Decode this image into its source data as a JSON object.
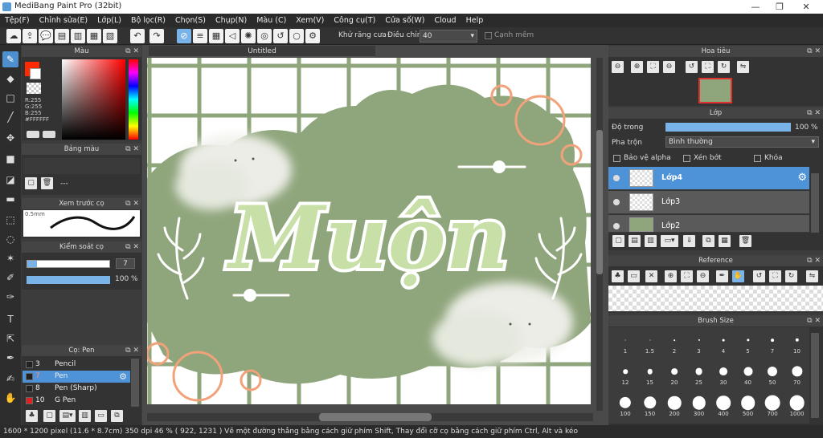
{
  "title": "MediBang Paint Pro (32bit)",
  "menu": [
    "Tệp(F)",
    "Chỉnh sửa(E)",
    "Lớp(L)",
    "Bộ lọc(R)",
    "Chọn(S)",
    "Chụp(N)",
    "Màu (C)",
    "Xem(V)",
    "Công cụ(T)",
    "Cửa số(W)",
    "Cloud",
    "Help"
  ],
  "toolbar": {
    "antialias_label": "Khử răng cưa",
    "adjust_label": "Điều chỉnh",
    "adjust_value": "40",
    "snap_label": "Cạnh mềm"
  },
  "color_panel": {
    "title": "Màu",
    "r": "R:255",
    "g": "G:255",
    "b": "B:255",
    "hex": "#FFFFFF",
    "fg": "#ff2a00",
    "bg": "#ffffff"
  },
  "palette_panel": {
    "title": "Bảng màu",
    "dots": "---"
  },
  "preview_panel": {
    "title": "Xem trước cọ",
    "size": "0.5mm"
  },
  "control_panel": {
    "title": "Kiểm soát cọ",
    "size_value": "7",
    "opacity_value": "100 %"
  },
  "brush_panel": {
    "title": "Cọ: Pen",
    "items": [
      {
        "num": "3",
        "name": "Pencil",
        "color": "#222222"
      },
      {
        "num": "7",
        "name": "Pen",
        "color": "#222222"
      },
      {
        "num": "8",
        "name": "Pen (Sharp)",
        "color": "#222222"
      },
      {
        "num": "10",
        "name": "G Pen",
        "color": "#e02020"
      }
    ]
  },
  "document_tab": "Untitled",
  "artwork": {
    "text": "Muộn",
    "bg_color": "#8fa57c",
    "grid_color": "#8fa57c",
    "accent": "#f2a27a"
  },
  "navigator_panel": {
    "title": "Hoa tiêu"
  },
  "layer_panel": {
    "title": "Lớp",
    "opacity_label": "Độ trong",
    "opacity_value": "100 %",
    "blend_label": "Pha trộn",
    "blend_value": "Bình thường",
    "protect_alpha": "Bảo vệ alpha",
    "clipping": "Xén bớt",
    "lock": "Khóa",
    "layers": [
      {
        "name": "Lớp4"
      },
      {
        "name": "Lớp3"
      },
      {
        "name": "Lớp2"
      }
    ]
  },
  "reference_panel": {
    "title": "Reference"
  },
  "brushsize_panel": {
    "title": "Brush Size",
    "sizes": [
      "1",
      "1.5",
      "2",
      "3",
      "4",
      "5",
      "7",
      "10",
      "12",
      "15",
      "20",
      "25",
      "30",
      "40",
      "50",
      "70",
      "100",
      "150",
      "200",
      "300",
      "400",
      "500",
      "700",
      "1000"
    ]
  },
  "status": "1600 * 1200 pixel   (11.6 * 8.7cm)  350 dpi   46 %   ( 922, 1231 )   Vẽ một đường thẳng bằng cách giữ phím Shift, Thay đổi cỡ cọ bằng cách giữ phím Ctrl, Alt và kéo"
}
